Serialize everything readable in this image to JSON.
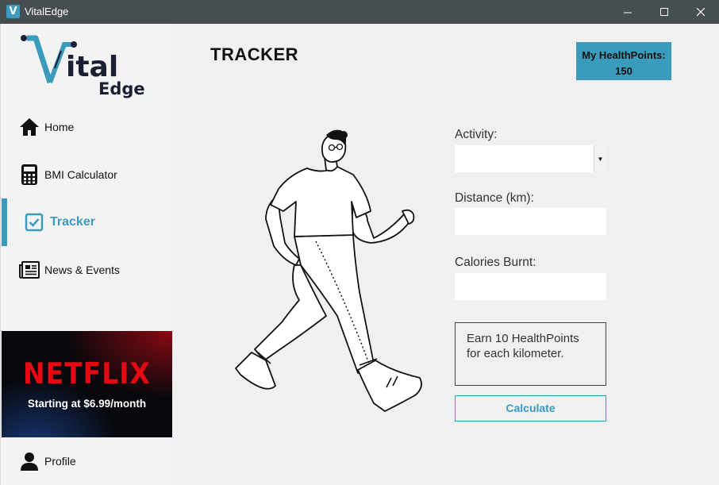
{
  "window": {
    "title": "VitalEdge",
    "icon_letter": "V"
  },
  "logo": {
    "line1": "ital",
    "line2": "Edge"
  },
  "sidebar": {
    "items": [
      {
        "label": "Home",
        "icon": "home-icon"
      },
      {
        "label": "BMI Calculator",
        "icon": "calculator-icon"
      },
      {
        "label": "Tracker",
        "icon": "checkbox-icon",
        "active": true
      },
      {
        "label": "News & Events",
        "icon": "newspaper-icon"
      }
    ],
    "profile": {
      "label": "Profile",
      "icon": "user-icon"
    }
  },
  "ad": {
    "brand": "NETFLIX",
    "text": "Starting at $6.99/month"
  },
  "main": {
    "title": "TRACKER",
    "healthpoints": {
      "label": "My HealthPoints:",
      "value": "150"
    },
    "form": {
      "activity_label": "Activity:",
      "activity_value": "",
      "distance_label": "Distance (km):",
      "distance_value": "",
      "calories_label": "Calories Burnt:",
      "calories_value": "",
      "info_text": "Earn 10 HealthPoints for each kilometer.",
      "calculate_label": "Calculate"
    }
  },
  "colors": {
    "accent": "#3b9bbd",
    "titlebar": "#464e52",
    "ad_brand": "#e50914"
  }
}
